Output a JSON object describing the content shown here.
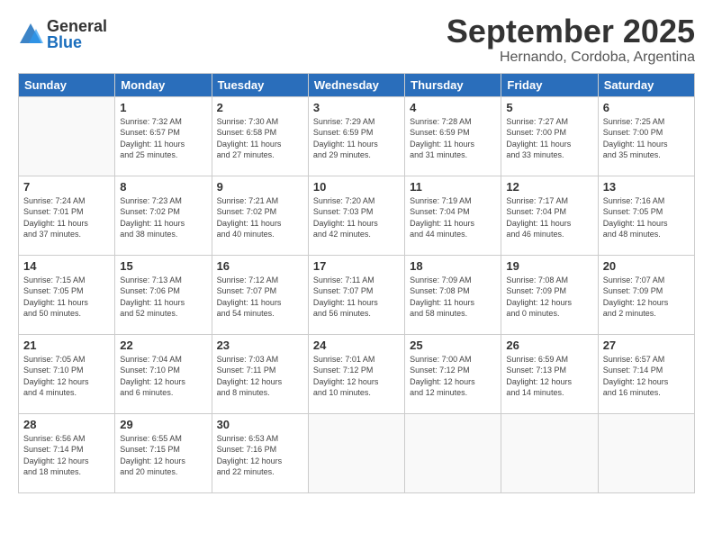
{
  "logo": {
    "general": "General",
    "blue": "Blue"
  },
  "title": "September 2025",
  "location": "Hernando, Cordoba, Argentina",
  "headers": [
    "Sunday",
    "Monday",
    "Tuesday",
    "Wednesday",
    "Thursday",
    "Friday",
    "Saturday"
  ],
  "weeks": [
    [
      {
        "day": "",
        "info": ""
      },
      {
        "day": "1",
        "info": "Sunrise: 7:32 AM\nSunset: 6:57 PM\nDaylight: 11 hours\nand 25 minutes."
      },
      {
        "day": "2",
        "info": "Sunrise: 7:30 AM\nSunset: 6:58 PM\nDaylight: 11 hours\nand 27 minutes."
      },
      {
        "day": "3",
        "info": "Sunrise: 7:29 AM\nSunset: 6:59 PM\nDaylight: 11 hours\nand 29 minutes."
      },
      {
        "day": "4",
        "info": "Sunrise: 7:28 AM\nSunset: 6:59 PM\nDaylight: 11 hours\nand 31 minutes."
      },
      {
        "day": "5",
        "info": "Sunrise: 7:27 AM\nSunset: 7:00 PM\nDaylight: 11 hours\nand 33 minutes."
      },
      {
        "day": "6",
        "info": "Sunrise: 7:25 AM\nSunset: 7:00 PM\nDaylight: 11 hours\nand 35 minutes."
      }
    ],
    [
      {
        "day": "7",
        "info": "Sunrise: 7:24 AM\nSunset: 7:01 PM\nDaylight: 11 hours\nand 37 minutes."
      },
      {
        "day": "8",
        "info": "Sunrise: 7:23 AM\nSunset: 7:02 PM\nDaylight: 11 hours\nand 38 minutes."
      },
      {
        "day": "9",
        "info": "Sunrise: 7:21 AM\nSunset: 7:02 PM\nDaylight: 11 hours\nand 40 minutes."
      },
      {
        "day": "10",
        "info": "Sunrise: 7:20 AM\nSunset: 7:03 PM\nDaylight: 11 hours\nand 42 minutes."
      },
      {
        "day": "11",
        "info": "Sunrise: 7:19 AM\nSunset: 7:04 PM\nDaylight: 11 hours\nand 44 minutes."
      },
      {
        "day": "12",
        "info": "Sunrise: 7:17 AM\nSunset: 7:04 PM\nDaylight: 11 hours\nand 46 minutes."
      },
      {
        "day": "13",
        "info": "Sunrise: 7:16 AM\nSunset: 7:05 PM\nDaylight: 11 hours\nand 48 minutes."
      }
    ],
    [
      {
        "day": "14",
        "info": "Sunrise: 7:15 AM\nSunset: 7:05 PM\nDaylight: 11 hours\nand 50 minutes."
      },
      {
        "day": "15",
        "info": "Sunrise: 7:13 AM\nSunset: 7:06 PM\nDaylight: 11 hours\nand 52 minutes."
      },
      {
        "day": "16",
        "info": "Sunrise: 7:12 AM\nSunset: 7:07 PM\nDaylight: 11 hours\nand 54 minutes."
      },
      {
        "day": "17",
        "info": "Sunrise: 7:11 AM\nSunset: 7:07 PM\nDaylight: 11 hours\nand 56 minutes."
      },
      {
        "day": "18",
        "info": "Sunrise: 7:09 AM\nSunset: 7:08 PM\nDaylight: 11 hours\nand 58 minutes."
      },
      {
        "day": "19",
        "info": "Sunrise: 7:08 AM\nSunset: 7:09 PM\nDaylight: 12 hours\nand 0 minutes."
      },
      {
        "day": "20",
        "info": "Sunrise: 7:07 AM\nSunset: 7:09 PM\nDaylight: 12 hours\nand 2 minutes."
      }
    ],
    [
      {
        "day": "21",
        "info": "Sunrise: 7:05 AM\nSunset: 7:10 PM\nDaylight: 12 hours\nand 4 minutes."
      },
      {
        "day": "22",
        "info": "Sunrise: 7:04 AM\nSunset: 7:10 PM\nDaylight: 12 hours\nand 6 minutes."
      },
      {
        "day": "23",
        "info": "Sunrise: 7:03 AM\nSunset: 7:11 PM\nDaylight: 12 hours\nand 8 minutes."
      },
      {
        "day": "24",
        "info": "Sunrise: 7:01 AM\nSunset: 7:12 PM\nDaylight: 12 hours\nand 10 minutes."
      },
      {
        "day": "25",
        "info": "Sunrise: 7:00 AM\nSunset: 7:12 PM\nDaylight: 12 hours\nand 12 minutes."
      },
      {
        "day": "26",
        "info": "Sunrise: 6:59 AM\nSunset: 7:13 PM\nDaylight: 12 hours\nand 14 minutes."
      },
      {
        "day": "27",
        "info": "Sunrise: 6:57 AM\nSunset: 7:14 PM\nDaylight: 12 hours\nand 16 minutes."
      }
    ],
    [
      {
        "day": "28",
        "info": "Sunrise: 6:56 AM\nSunset: 7:14 PM\nDaylight: 12 hours\nand 18 minutes."
      },
      {
        "day": "29",
        "info": "Sunrise: 6:55 AM\nSunset: 7:15 PM\nDaylight: 12 hours\nand 20 minutes."
      },
      {
        "day": "30",
        "info": "Sunrise: 6:53 AM\nSunset: 7:16 PM\nDaylight: 12 hours\nand 22 minutes."
      },
      {
        "day": "",
        "info": ""
      },
      {
        "day": "",
        "info": ""
      },
      {
        "day": "",
        "info": ""
      },
      {
        "day": "",
        "info": ""
      }
    ]
  ]
}
